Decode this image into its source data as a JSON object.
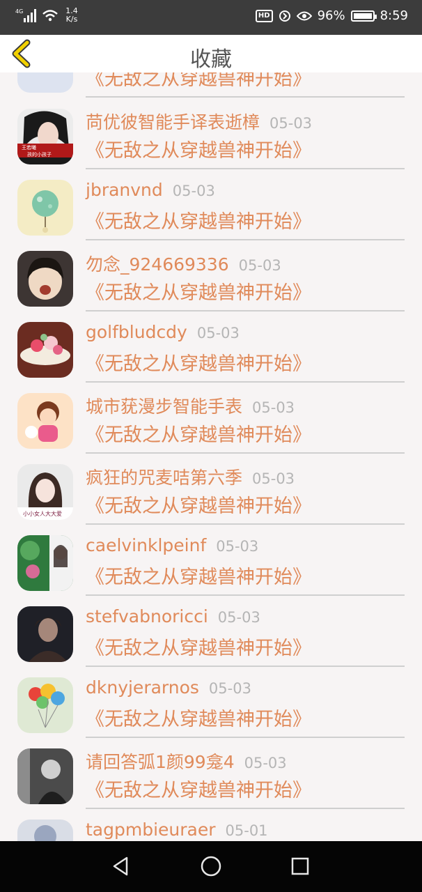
{
  "status_bar": {
    "signal": "4G",
    "speed_value": "1.4",
    "speed_unit": "K/s",
    "hd": "HD",
    "battery_pct": "96%",
    "time": "8:59"
  },
  "header": {
    "title": "收藏",
    "back_icon": "chevron-left-icon"
  },
  "entries": [
    {
      "name": "",
      "date": "",
      "book": "《无敌之从穿越兽神开始》"
    },
    {
      "name": "苘优彼智能手译表逝樟",
      "date": "05-03",
      "book": "《无敌之从穿越兽神开始》"
    },
    {
      "name": "jbranvnd",
      "date": "05-03",
      "book": "《无敌之从穿越兽神开始》"
    },
    {
      "name": "勿念_924669336",
      "date": "05-03",
      "book": "《无敌之从穿越兽神开始》"
    },
    {
      "name": "golfbludcdy",
      "date": "05-03",
      "book": "《无敌之从穿越兽神开始》"
    },
    {
      "name": "城市莸漫步智能手表",
      "date": "05-03",
      "book": "《无敌之从穿越兽神开始》"
    },
    {
      "name": "疯狂的咒麦咭第六季",
      "date": "05-03",
      "book": "《无敌之从穿越兽神开始》"
    },
    {
      "name": "caelvinklpeinf",
      "date": "05-03",
      "book": "《无敌之从穿越兽神开始》"
    },
    {
      "name": "stefvabnoricci",
      "date": "05-03",
      "book": "《无敌之从穿越兽神开始》"
    },
    {
      "name": "dknyjerarnos",
      "date": "05-03",
      "book": "《无敌之从穿越兽神开始》"
    },
    {
      "name": "请回答弧1颜99龛4",
      "date": "05-03",
      "book": "《无敌之从穿越兽神开始》"
    },
    {
      "name": "tagpmbieuraer",
      "date": "05-01",
      "book": ""
    }
  ],
  "avatar_texts": {
    "row1_line1": "王若曦",
    "row1_line2": "孩的小孩子",
    "row6_caption": "小小女人大大爱"
  },
  "nav": {
    "back": "triangle-back-icon",
    "home": "circle-home-icon",
    "recents": "square-recents-icon"
  },
  "colors": {
    "accent": "#e08a5a",
    "date": "#b5b5b5",
    "background": "#f7f4f4"
  }
}
